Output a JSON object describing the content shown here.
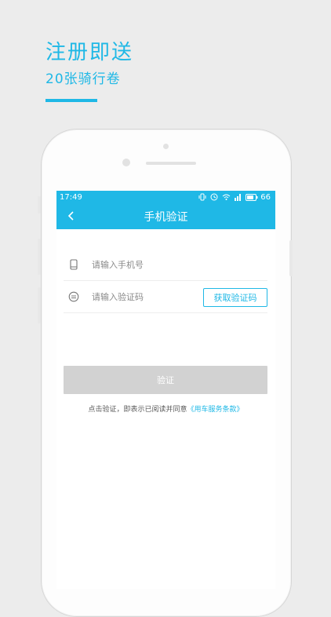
{
  "promo": {
    "title": "注册即送",
    "subtitle": "20张骑行卷"
  },
  "status": {
    "time": "17:49",
    "battery": "66"
  },
  "nav": {
    "title": "手机验证"
  },
  "form": {
    "phone_placeholder": "请输入手机号",
    "code_placeholder": "请输入验证码",
    "get_code_label": "获取验证码",
    "verify_label": "验证"
  },
  "agreement": {
    "prefix": "点击验证，即表示已阅读并同意",
    "link": "《用车服务条款》"
  },
  "colors": {
    "accent": "#1fb8e6",
    "disabled": "#d2d2d2"
  }
}
